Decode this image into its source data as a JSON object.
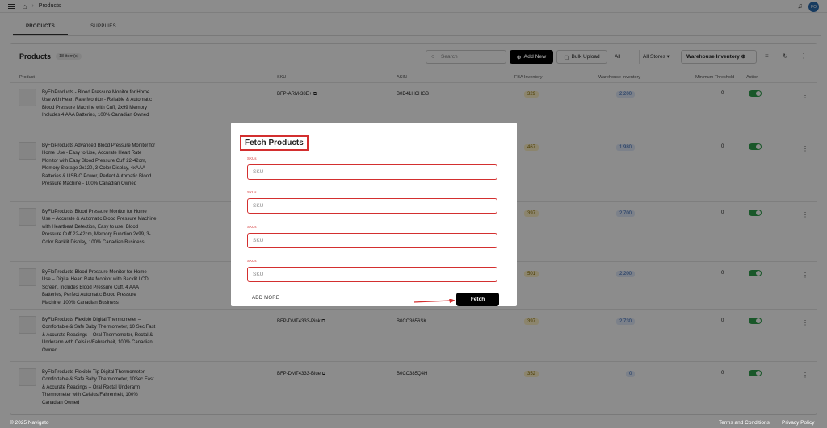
{
  "topbar": {
    "breadcrumb": "Products",
    "avatar": "FO"
  },
  "tabs": [
    "PRODUCTS",
    "SUPPLIES"
  ],
  "card": {
    "title": "Products",
    "count": "18 item(s)",
    "search_placeholder": "Search",
    "add_new": "Add New",
    "bulk_upload": "Bulk Upload",
    "all_label": "All",
    "stores_label": "All Stores",
    "warehouse_inventory": "Warehouse Inventory"
  },
  "columns": [
    "Product",
    "SKU",
    "ASIN",
    "FBA Inventory",
    "Warehouse Inventory",
    "Minimum Threshold",
    "Action"
  ],
  "rows": [
    {
      "name": "ByFloProducts - Blood Pressure Monitor for Home Use with Heart Rate Monitor - Reliable & Automatic Blood Pressure Machine with Cuff, 2x99 Memory Includes 4 AAA Batteries, 100% Canadian Owned",
      "sku": "BFP-ARM-38E+",
      "asin": "B0D41HCHGB",
      "fba": "329",
      "warehouse": "2,200",
      "min": "0"
    },
    {
      "name": "ByFloProducts Advanced Blood Pressure Monitor for Home Use - Easy to Use, Accurate Heart Rate Monitor with Easy Blood Pressure Cuff 22-42cm, Memory Storage 2x120, 3-Color Display, 4xAAA Batteries & USB-C Power, Perfect Automatic Blood Pressure Machine - 100% Canadian Owned",
      "sku": "",
      "asin": "",
      "fba": "467",
      "warehouse": "1,980",
      "min": "0"
    },
    {
      "name": "ByFloProducts Blood Pressure Monitor for Home Use – Accurate & Automatic Blood Pressure Machine with Heartbeat Detection, Easy to use, Blood Pressure Cuff 22-42cm, Memory Function 2x99, 3-Color Backlit Display, 100% Canadian Business",
      "sku": "",
      "asin": "",
      "fba": "397",
      "warehouse": "2,700",
      "min": "0"
    },
    {
      "name": "ByFloProducts Blood Pressure Monitor for Home Use – Digital Heart Rate Monitor with Backlit LCD Screen, Includes Blood Pressure Cuff, 4 AAA Batteries, Perfect Automatic Blood Pressure Machine, 100% Canadian Business",
      "sku": "",
      "asin": "",
      "fba": "501",
      "warehouse": "2,200",
      "min": "0"
    },
    {
      "name": "ByFloProducts Flexible Digital Thermometer – Comfortable & Safe Baby Thermometer, 10 Sec Fast & Accurate Readings – Oral Thermometer, Rectal & Underarm with Celsius/Fahrenheit, 100% Canadian Owned",
      "sku": "BFP-DMT4333-Pink",
      "asin": "B0CC3656SK",
      "fba": "397",
      "warehouse": "2,730",
      "min": "0"
    },
    {
      "name": "ByFloProducts Flexible Tip Digital Thermometer – Comfortable & Safe Baby Thermometer, 10Sec Fast & Accurate Readings – Oral Rectal Underarm Thermometer with Celsius/Fahrenheit, 100% Canadian Owned",
      "sku": "BFP-DMT4333-Blue",
      "asin": "B0CC385Q4H",
      "fba": "352",
      "warehouse": "0",
      "min": "0"
    }
  ],
  "footer": {
    "copyright": "© 2025 Navigato",
    "terms": "Terms and Conditions",
    "privacy": "Privacy Policy"
  },
  "modal": {
    "title": "Fetch Products",
    "field_label": "SKUs",
    "placeholder": "SKU",
    "add_more": "ADD MORE",
    "fetch": "Fetch"
  }
}
